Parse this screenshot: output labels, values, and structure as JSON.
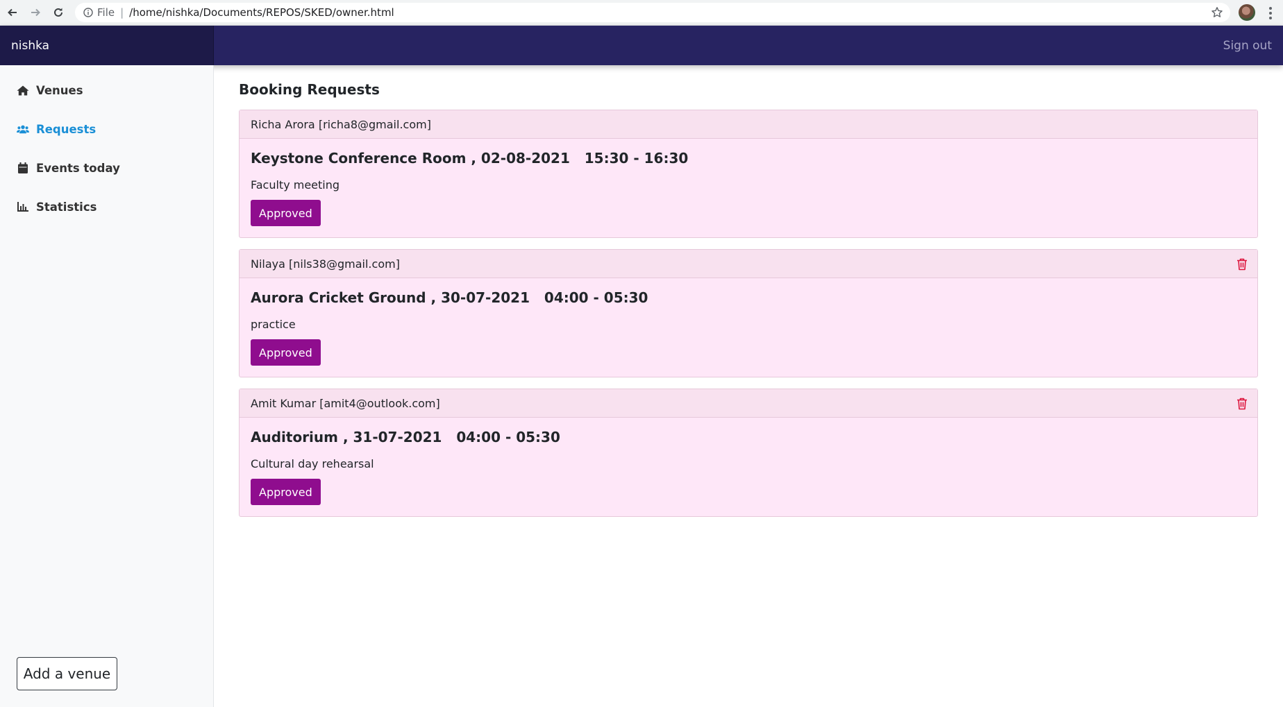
{
  "browser": {
    "scheme": "File",
    "url": "/home/nishka/Documents/REPOS/SKED/owner.html"
  },
  "navbar": {
    "brand": "nishka",
    "signout_label": "Sign out",
    "colors": {
      "navbar": "#272361",
      "brand_bg": "#1d1a48"
    }
  },
  "sidebar": {
    "items": [
      {
        "label": "Venues",
        "icon": "home-icon",
        "active": false
      },
      {
        "label": "Requests",
        "icon": "users-icon",
        "active": true
      },
      {
        "label": "Events today",
        "icon": "calendar-icon",
        "active": false
      },
      {
        "label": "Statistics",
        "icon": "chart-icon",
        "active": false
      }
    ],
    "add_venue_label": "Add a venue"
  },
  "main": {
    "title": "Booking Requests",
    "requests": [
      {
        "requester": "Richa Arora [richa8@gmail.com]",
        "title": "Keystone Conference Room , 02-08-2021   15:30 - 16:30",
        "description": "Faculty meeting",
        "status": "Approved",
        "deletable": false
      },
      {
        "requester": "Nilaya [nils38@gmail.com]",
        "title": "Aurora Cricket Ground , 30-07-2021   04:00 - 05:30",
        "description": "practice",
        "status": "Approved",
        "deletable": true
      },
      {
        "requester": "Amit Kumar [amit4@outlook.com]",
        "title": "Auditorium , 31-07-2021   04:00 - 05:30",
        "description": "Cultural day rehearsal",
        "status": "Approved",
        "deletable": true
      }
    ],
    "colors": {
      "card_bg": "#fee7f8",
      "status_button": "#8f0d8e",
      "delete_icon": "#dc143c"
    }
  }
}
